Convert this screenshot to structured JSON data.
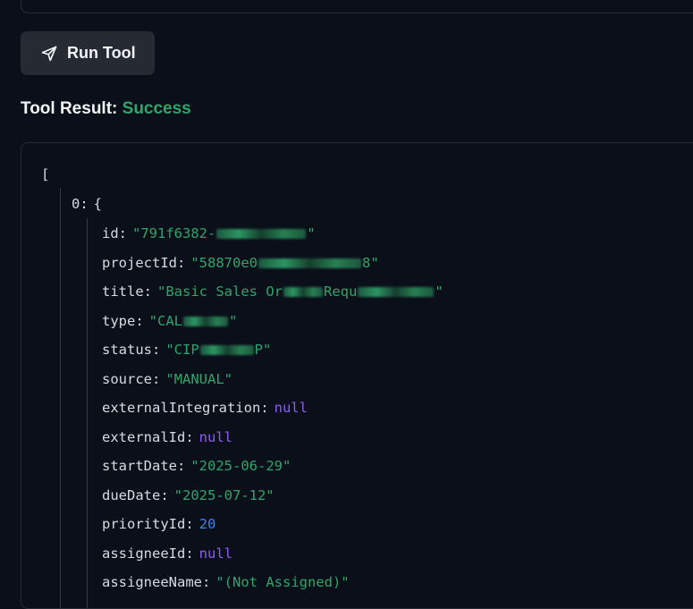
{
  "toolbar": {
    "run_label": "Run Tool"
  },
  "result": {
    "heading_label": "Tool Result:",
    "status": "Success"
  },
  "json_view": {
    "open_bracket": "[",
    "item_index": "0:",
    "item_open": "{",
    "fields": [
      {
        "key": "id:",
        "value_prefix": "\"791f6382-",
        "value_suffix": "\"",
        "type": "string",
        "redacted": true
      },
      {
        "key": "projectId:",
        "value_prefix": "\"58870e0",
        "value_suffix": "8\"",
        "type": "string",
        "redacted": true
      },
      {
        "key": "title:",
        "value_prefix": "\"Basic Sales Or",
        "value_mid": "Requ",
        "value_suffix": "\"",
        "type": "string",
        "redacted": true
      },
      {
        "key": "type:",
        "value_prefix": "\"CAL",
        "value_suffix": "\"",
        "type": "string",
        "redacted": true
      },
      {
        "key": "status:",
        "value_prefix": "\"CIP",
        "value_suffix": "P\"",
        "type": "string",
        "redacted": true
      },
      {
        "key": "source:",
        "value": "\"MANUAL\"",
        "type": "string"
      },
      {
        "key": "externalIntegration:",
        "value": "null",
        "type": "null"
      },
      {
        "key": "externalId:",
        "value": "null",
        "type": "null"
      },
      {
        "key": "startDate:",
        "value": "\"2025-06-29\"",
        "type": "string"
      },
      {
        "key": "dueDate:",
        "value": "\"2025-07-12\"",
        "type": "string"
      },
      {
        "key": "priorityId:",
        "value": "20",
        "type": "number"
      },
      {
        "key": "assigneeId:",
        "value": "null",
        "type": "null"
      },
      {
        "key": "assigneeName:",
        "value": "\"(Not Assigned)\"",
        "type": "string"
      }
    ]
  },
  "colors": {
    "background": "#0b0f19",
    "string": "#2fa56a",
    "null": "#8d5cf6",
    "number": "#3b82f6",
    "button_bg": "#262a33"
  },
  "icons": {
    "run": "send-icon"
  }
}
